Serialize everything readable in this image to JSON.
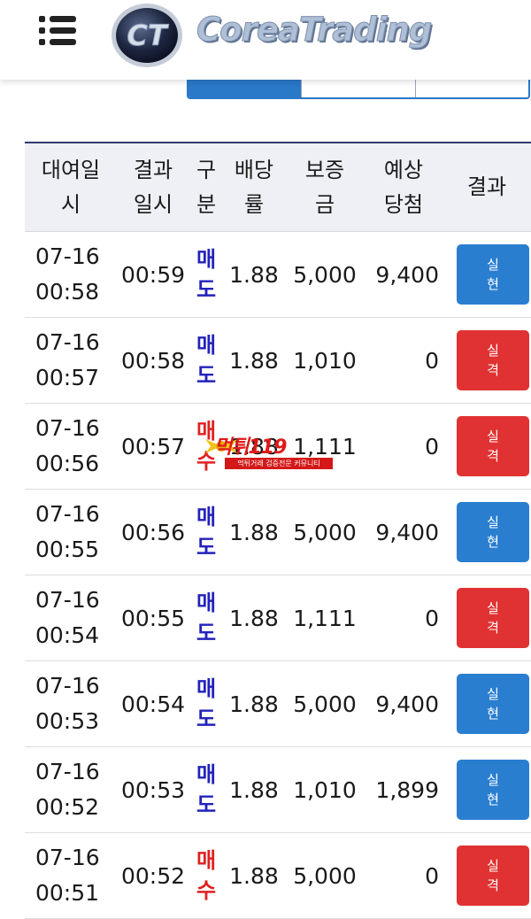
{
  "header": {
    "logo_text": "CoreaTrading",
    "emblem_text": "CT",
    "tabs": [
      "",
      "",
      ""
    ]
  },
  "table": {
    "columns": [
      "대여일시",
      "결과일시",
      "구분",
      "배당률",
      "보증금",
      "예상당첨",
      "결과"
    ],
    "columns_lines": [
      [
        "대여일",
        "시"
      ],
      [
        "결과",
        "일시"
      ],
      [
        "구",
        "분"
      ],
      [
        "배당",
        "률"
      ],
      [
        "보증",
        "금"
      ],
      [
        "예상",
        "당첨"
      ],
      [
        "결과"
      ]
    ],
    "rows": [
      {
        "date": "07-16",
        "time": "00:58",
        "result_time": "00:59",
        "type": [
          "매",
          "도"
        ],
        "kind": "sell",
        "odds": "1.88",
        "deposit": "5,000",
        "expected": "9,400",
        "result": [
          "실",
          "현"
        ],
        "outcome": "win"
      },
      {
        "date": "07-16",
        "time": "00:57",
        "result_time": "00:58",
        "type": [
          "매",
          "도"
        ],
        "kind": "sell",
        "odds": "1.88",
        "deposit": "1,010",
        "expected": "0",
        "result": [
          "실",
          "격"
        ],
        "outcome": "lose"
      },
      {
        "date": "07-16",
        "time": "00:56",
        "result_time": "00:57",
        "type": [
          "매",
          "수"
        ],
        "kind": "buy",
        "odds": "1.88",
        "deposit": "1,111",
        "expected": "0",
        "result": [
          "실",
          "격"
        ],
        "outcome": "lose"
      },
      {
        "date": "07-16",
        "time": "00:55",
        "result_time": "00:56",
        "type": [
          "매",
          "도"
        ],
        "kind": "sell",
        "odds": "1.88",
        "deposit": "5,000",
        "expected": "9,400",
        "result": [
          "실",
          "현"
        ],
        "outcome": "win"
      },
      {
        "date": "07-16",
        "time": "00:54",
        "result_time": "00:55",
        "type": [
          "매",
          "도"
        ],
        "kind": "sell",
        "odds": "1.88",
        "deposit": "1,111",
        "expected": "0",
        "result": [
          "실",
          "격"
        ],
        "outcome": "lose"
      },
      {
        "date": "07-16",
        "time": "00:53",
        "result_time": "00:54",
        "type": [
          "매",
          "도"
        ],
        "kind": "sell",
        "odds": "1.88",
        "deposit": "5,000",
        "expected": "9,400",
        "result": [
          "실",
          "현"
        ],
        "outcome": "win"
      },
      {
        "date": "07-16",
        "time": "00:52",
        "result_time": "00:53",
        "type": [
          "매",
          "도"
        ],
        "kind": "sell",
        "odds": "1.88",
        "deposit": "1,010",
        "expected": "1,899",
        "result": [
          "실",
          "현"
        ],
        "outcome": "win"
      },
      {
        "date": "07-16",
        "time": "00:51",
        "result_time": "00:52",
        "type": [
          "매",
          "수"
        ],
        "kind": "buy",
        "odds": "1.88",
        "deposit": "5,000",
        "expected": "0",
        "result": [
          "실",
          "격"
        ],
        "outcome": "lose"
      }
    ]
  },
  "watermark": {
    "title": "먹튀119",
    "subtitle": "먹튀거래 검증전문 커뮤니티"
  },
  "colors": {
    "sell": "#2222bb",
    "buy": "#e02020",
    "win": "#2a7ed0",
    "lose": "#e03232",
    "accent": "#2a78c8"
  }
}
